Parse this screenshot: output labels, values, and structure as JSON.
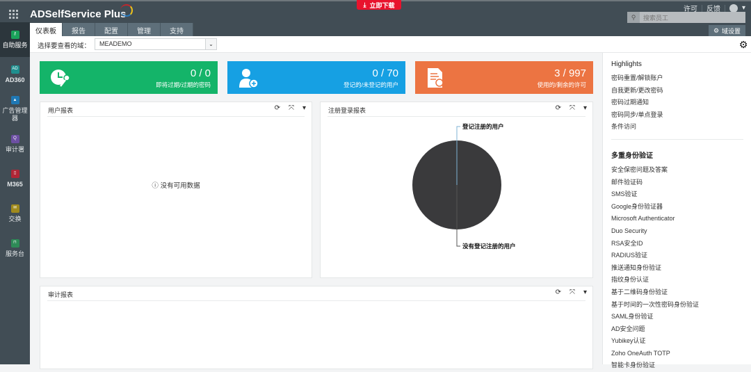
{
  "header": {
    "app_title": "ADSelfService Plus",
    "download_label": "立即下载",
    "links": [
      "许可",
      "反馈"
    ],
    "search_placeholder": "搜索员工",
    "domain_settings_label": "域设置"
  },
  "tabs": [
    {
      "label": "仪表板"
    },
    {
      "label": "报告"
    },
    {
      "label": "配置"
    },
    {
      "label": "管理"
    },
    {
      "label": "支持"
    }
  ],
  "sidebar": [
    {
      "label": "自助服务",
      "icon": "key-icon",
      "color": "#1aa35a"
    },
    {
      "label": "AD360",
      "icon": "ad360-icon",
      "color": "#1f8f8f"
    },
    {
      "label": "广告管理器",
      "icon": "admanager-icon",
      "color": "#1f78b4"
    },
    {
      "label": "审计署",
      "icon": "audit-icon",
      "color": "#6c4fa3"
    },
    {
      "label": "M365",
      "icon": "office-icon",
      "color": "#b02636"
    },
    {
      "label": "交换",
      "icon": "mail-icon",
      "color": "#a08a1d"
    },
    {
      "label": "服务台",
      "icon": "servicedesk-icon",
      "color": "#2e8b57"
    }
  ],
  "domain": {
    "label": "选择要查看的域：",
    "value": "MEADEMO"
  },
  "cards": [
    {
      "value": "0 / 0",
      "label": "即将过期/过期的密码",
      "color": "#14b469"
    },
    {
      "value": "0 / 70",
      "label": "登记的/未登记的用户",
      "color": "#16a0e3"
    },
    {
      "value": "3 / 997",
      "label": "使用的/剩余的许可",
      "color": "#ec7442"
    }
  ],
  "panels": {
    "user_report": "用户报表",
    "no_data": "没有可用数据",
    "enroll_report": "注册登录报表",
    "audit_report": "审计报表"
  },
  "chart_data": {
    "type": "pie",
    "title": "注册登录报表",
    "categories": [
      "登记注册的用户",
      "没有登记注册的用户"
    ],
    "values": [
      0,
      70
    ],
    "colors": [
      "#3a3a3c",
      "#3a3a3c"
    ]
  },
  "highlights": {
    "title": "Highlights",
    "items": [
      "密码重置/解锁账户",
      "自我更新/更改密码",
      "密码过期通知",
      "密码同步/单点登录",
      "条件访问"
    ]
  },
  "mfa": {
    "title": "多重身份验证",
    "items": [
      "安全保密问题及答案",
      "邮件验证码",
      "SMS验证",
      "Google身份验证器",
      "Microsoft Authenticator",
      "Duo Security",
      "RSA安全ID",
      "RADIUS验证",
      "推送通知身份验证",
      "指纹身份认证",
      "基于二维码身份验证",
      "基于时间的一次性密码身份验证",
      "SAML身份验证",
      "AD安全问题",
      "Yubikey认证",
      "Zoho OneAuth TOTP",
      "智能卡身份验证"
    ]
  }
}
